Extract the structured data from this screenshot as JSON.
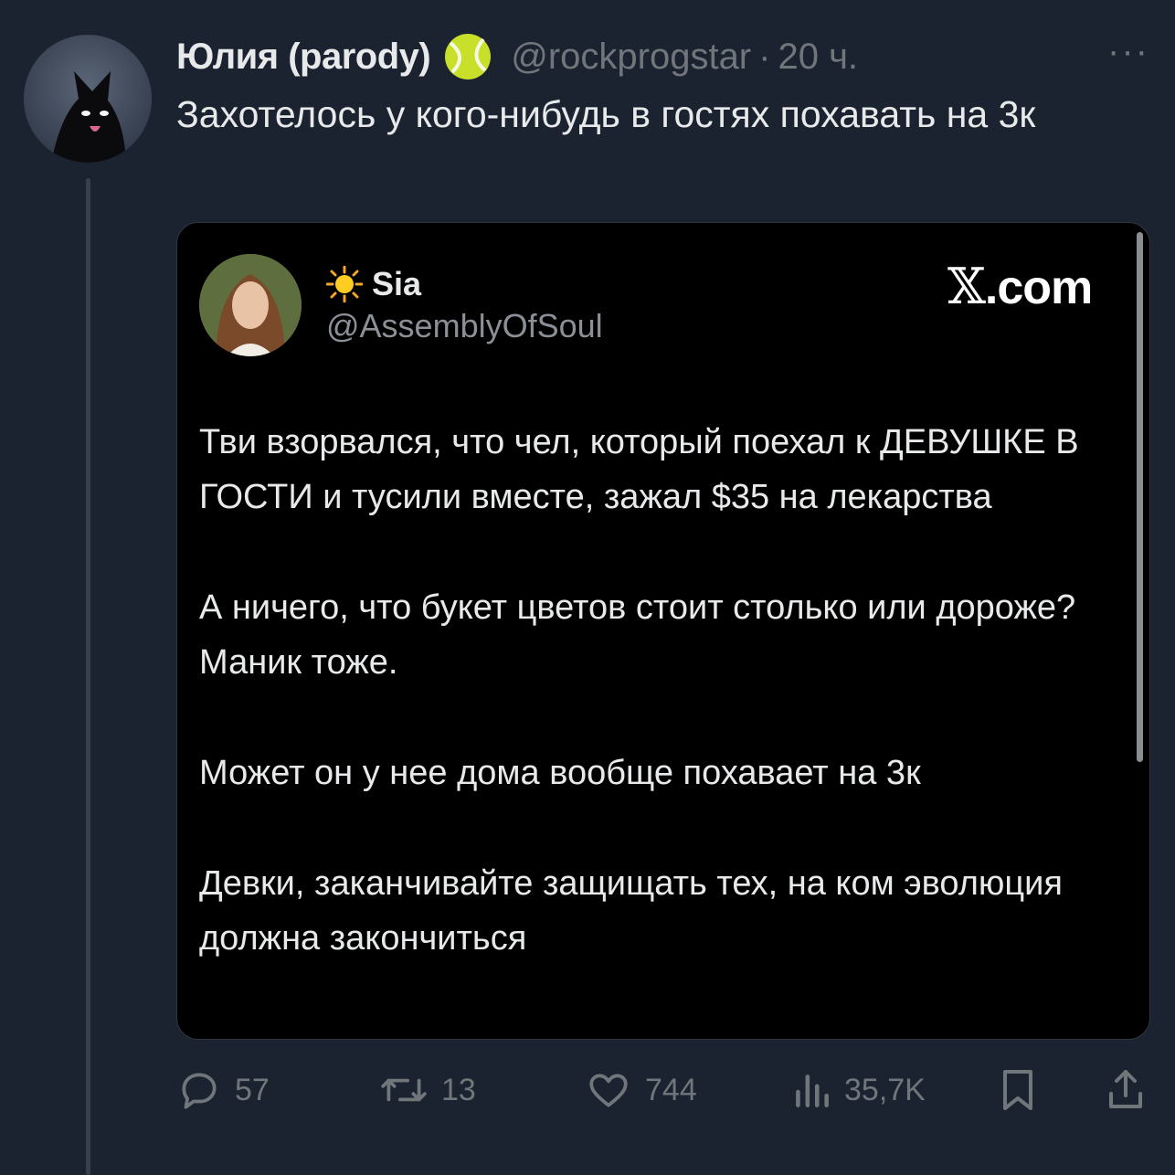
{
  "tweet": {
    "author_name": "Юлия (parody)",
    "handle": "@rockprogstar",
    "separator": "·",
    "time": "20 ч.",
    "more_label": "···",
    "text": "Захотелось у кого-нибудь в гостях похавать на 3к"
  },
  "quote": {
    "author_name": "Sia",
    "handle": "@AssemblyOfSoul",
    "brand_x": "𝕏",
    "brand_suffix": ".com",
    "paragraphs": [
      "Тви взорвался, что чел, который поехал к ДЕВУШКЕ В ГОСТИ и тусили вместе, зажал $35 на лекарства",
      "А ничего, что букет цветов стоит столько или дороже? Маник тоже.",
      "Может он у нее дома вообще похавает на 3к",
      "Девки, заканчивайте защищать тех, на ком эволюция должна закончиться"
    ]
  },
  "actions": {
    "replies": "57",
    "retweets": "13",
    "likes": "744",
    "views": "35,7K"
  },
  "colors": {
    "background": "#1b2330",
    "card": "#000000",
    "muted": "#71767b",
    "text": "#e7e9ea"
  }
}
